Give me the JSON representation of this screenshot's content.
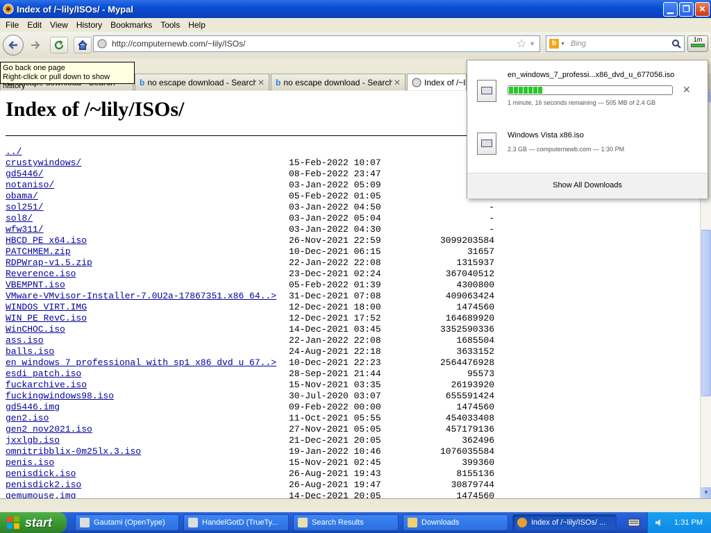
{
  "window": {
    "title": "Index of /~lily/ISOs/ - Mypal"
  },
  "menu": [
    "File",
    "Edit",
    "View",
    "History",
    "Bookmarks",
    "Tools",
    "Help"
  ],
  "toolbar": {
    "url": "http://computernewb.com/~lily/ISOs/",
    "search_placeholder": "Bing",
    "download_badge": "1m"
  },
  "tooltip": {
    "line1": "Go back one page",
    "line2": "Right-click or pull down to show history"
  },
  "tabs": [
    {
      "label": "no escape download - Search",
      "active": false
    },
    {
      "label": "no escape download - Search",
      "active": false
    },
    {
      "label": "no escape download - Search",
      "active": false
    },
    {
      "label": "Index of /~lily/ISOs/",
      "active": true
    }
  ],
  "page": {
    "heading": "Index of /~lily/ISOs/",
    "entries": [
      {
        "name": "../",
        "date": "",
        "size": ""
      },
      {
        "name": "crustywindows/",
        "date": "15-Feb-2022 10:07",
        "size": "-"
      },
      {
        "name": "gd5446/",
        "date": "08-Feb-2022 23:47",
        "size": "-"
      },
      {
        "name": "notaniso/",
        "date": "03-Jan-2022 05:09",
        "size": "-"
      },
      {
        "name": "obama/",
        "date": "05-Feb-2022 01:05",
        "size": "-"
      },
      {
        "name": "sol251/",
        "date": "03-Jan-2022 04:50",
        "size": "-"
      },
      {
        "name": "sol8/",
        "date": "03-Jan-2022 05:04",
        "size": "-"
      },
      {
        "name": "wfw311/",
        "date": "03-Jan-2022 04:30",
        "size": "-"
      },
      {
        "name": "HBCD_PE_x64.iso",
        "date": "26-Nov-2021 22:59",
        "size": "3099203584"
      },
      {
        "name": "PATCHMEM.zip",
        "date": "10-Dec-2021 06:15",
        "size": "31657"
      },
      {
        "name": "RDPWrap-v1.5.zip",
        "date": "22-Jan-2022 22:08",
        "size": "1315937"
      },
      {
        "name": "Reverence.iso",
        "date": "23-Dec-2021 02:24",
        "size": "367040512"
      },
      {
        "name": "VBEMPNT.iso",
        "date": "05-Feb-2022 01:39",
        "size": "4300800"
      },
      {
        "name": "VMware-VMvisor-Installer-7.0U2a-17867351.x86_64..>",
        "date": "31-Dec-2021 07:08",
        "size": "409063424"
      },
      {
        "name": "WINDOS_VIRT.IMG",
        "date": "12-Dec-2021 18:00",
        "size": "1474560"
      },
      {
        "name": "WIN_PE_RevC.iso",
        "date": "12-Dec-2021 17:52",
        "size": "164689920"
      },
      {
        "name": "WinCHOC.iso",
        "date": "14-Dec-2021 03:45",
        "size": "3352590336"
      },
      {
        "name": "ass.iso",
        "date": "22-Jan-2022 22:08",
        "size": "1685504"
      },
      {
        "name": "balls.iso",
        "date": "24-Aug-2021 22:18",
        "size": "3633152"
      },
      {
        "name": "en_windows_7_professional_with_sp1_x86_dvd_u_67..>",
        "date": "10-Dec-2021 22:23",
        "size": "2564476928"
      },
      {
        "name": "esdi_patch.iso",
        "date": "28-Sep-2021 21:44",
        "size": "95573"
      },
      {
        "name": "fuckarchive.iso",
        "date": "15-Nov-2021 03:35",
        "size": "26193920"
      },
      {
        "name": "fuckingwindows98.iso",
        "date": "30-Jul-2020 03:07",
        "size": "655591424"
      },
      {
        "name": "gd5446.img",
        "date": "09-Feb-2022 00:00",
        "size": "1474560"
      },
      {
        "name": "gen2.iso",
        "date": "11-Oct-2021 05:55",
        "size": "454033408"
      },
      {
        "name": "gen2_nov2021.iso",
        "date": "27-Nov-2021 05:05",
        "size": "457179136"
      },
      {
        "name": "jxxlgb.iso",
        "date": "21-Dec-2021 20:05",
        "size": "362496"
      },
      {
        "name": "omnitribblix-0m25lx.3.iso",
        "date": "19-Jan-2022 10:46",
        "size": "1076035584"
      },
      {
        "name": "penis.iso",
        "date": "15-Nov-2021 02:45",
        "size": "399360"
      },
      {
        "name": "penisdick.iso",
        "date": "26-Aug-2021 19:43",
        "size": "8155136"
      },
      {
        "name": "penisdick2.iso",
        "date": "26-Aug-2021 19:47",
        "size": "30879744"
      },
      {
        "name": "qemumouse.img",
        "date": "14-Dec-2021 20:05",
        "size": "1474560"
      }
    ]
  },
  "downloads": {
    "items": [
      {
        "name": "en_windows_7_professi...x86_dvd_u_677056.iso",
        "status": "1 minute, 16 seconds remaining — 505 MB of 2.4 GB",
        "progress": 0.21,
        "in_progress": true
      },
      {
        "name": "Windows Vista x86.iso",
        "status": "2.3 GB — computernewb.com — 1:30 PM",
        "in_progress": false
      }
    ],
    "footer": "Show All Downloads"
  },
  "taskbar": {
    "start": "start",
    "items": [
      {
        "label": "Gautami (OpenType)",
        "active": false
      },
      {
        "label": "HandelGotD (TrueTy...",
        "active": false
      },
      {
        "label": "Search Results",
        "active": false
      },
      {
        "label": "Downloads",
        "active": false
      },
      {
        "label": "Index of /~lily/ISOs/ ...",
        "active": true
      }
    ],
    "clock": "1:31 PM"
  },
  "colors": {
    "link": "#00009c",
    "titlebar": "#0a4fd6",
    "taskbar": "#245edb",
    "start": "#37952e",
    "progress": "#28c828"
  }
}
